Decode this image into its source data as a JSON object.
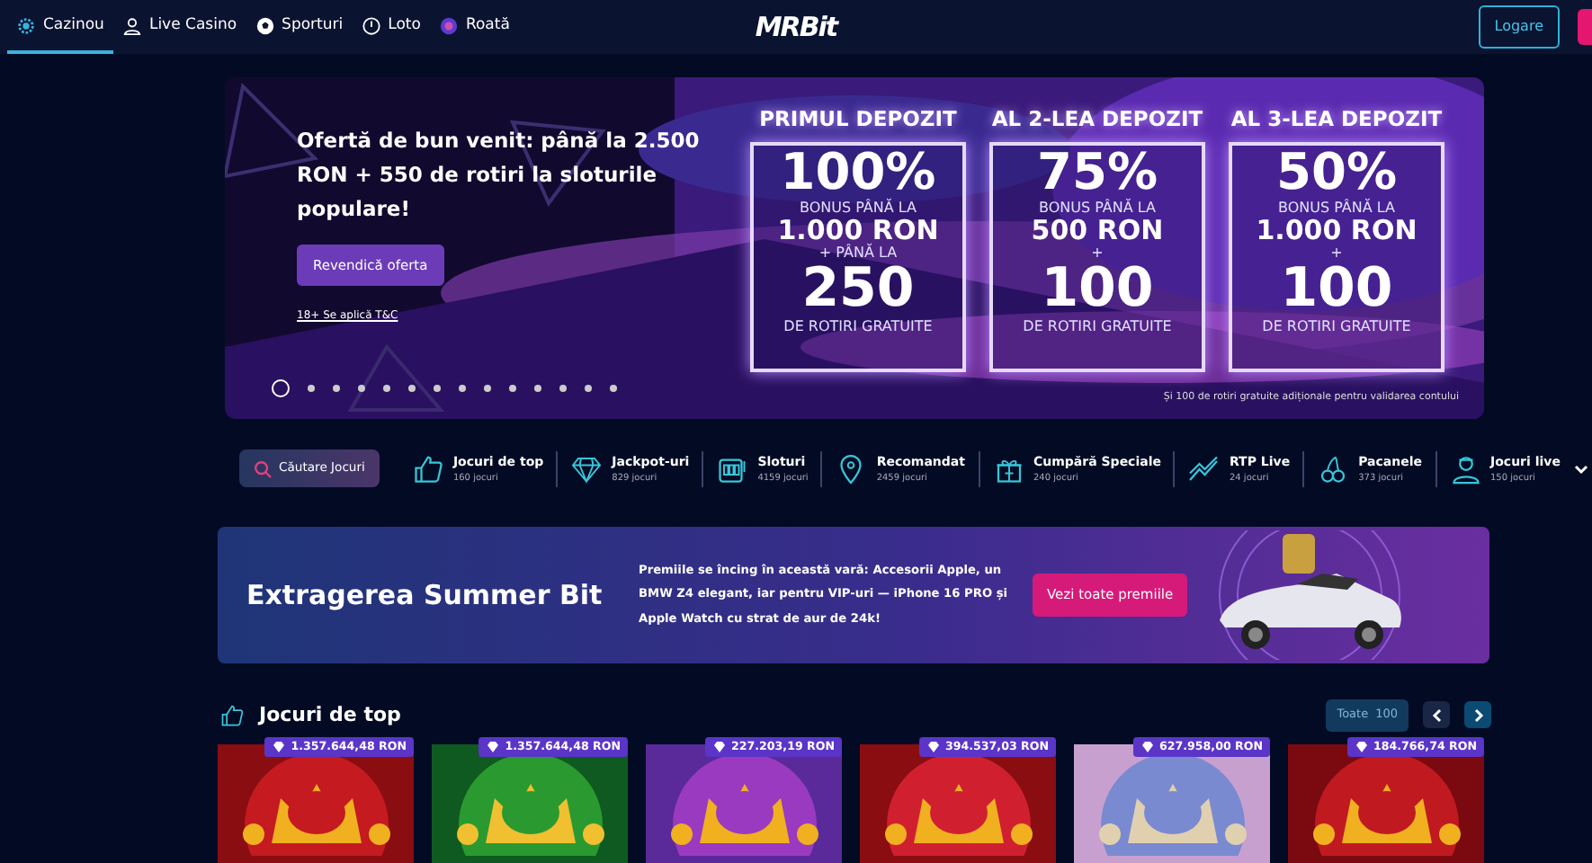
{
  "nav": {
    "items": [
      {
        "label": "Cazinou",
        "selected": true
      },
      {
        "label": "Live Casino",
        "selected": false
      },
      {
        "label": "Sporturi",
        "selected": false
      },
      {
        "label": "Loto",
        "selected": false
      },
      {
        "label": "Roată",
        "selected": false
      }
    ],
    "logo": "MRBit",
    "login": "Logare"
  },
  "hero": {
    "title": "Ofertă de bun venit: până la 2.500 RON + 550 de rotiri la sloturile populare!",
    "cta": "Revendică oferta",
    "terms": "18+ Se aplică T&C",
    "offers": [
      {
        "heading": "PRIMUL DEPOZIT",
        "percent": "100%",
        "lines": [
          "BONUS PÂNĂ LA",
          "1.000 RON",
          "+ PÂNĂ LA"
        ],
        "big": "250",
        "foot": "DE ROTIRI GRATUITE"
      },
      {
        "heading": "AL 2-LEA DEPOZIT",
        "percent": "75%",
        "lines": [
          "BONUS PÂNĂ LA",
          "500 RON",
          "+"
        ],
        "big": "100",
        "foot": "DE ROTIRI GRATUITE"
      },
      {
        "heading": "AL 3-LEA DEPOZIT",
        "percent": "50%",
        "lines": [
          "BONUS PÂNĂ LA",
          "1.000 RON",
          "+"
        ],
        "big": "100",
        "foot": "DE ROTIRI GRATUITE"
      }
    ],
    "note": "Și 100 de rotiri gratuite adiționale pentru validarea contului",
    "dots": [
      {
        "selected": true
      },
      {
        "selected": false
      },
      {
        "selected": false
      },
      {
        "selected": false
      },
      {
        "selected": false
      },
      {
        "selected": false
      },
      {
        "selected": false
      },
      {
        "selected": false
      },
      {
        "selected": false
      },
      {
        "selected": false
      },
      {
        "selected": false
      },
      {
        "selected": false
      },
      {
        "selected": false
      },
      {
        "selected": false
      }
    ]
  },
  "categories": {
    "search": "Căutare Jocuri",
    "items": [
      {
        "label": "Jocuri de top",
        "count": "160 jocuri"
      },
      {
        "label": "Jackpot-uri",
        "count": "829 jocuri"
      },
      {
        "label": "Sloturi",
        "count": "4159 jocuri"
      },
      {
        "label": "Recomandat",
        "count": "2459 jocuri"
      },
      {
        "label": "Cumpără Speciale",
        "count": "240 jocuri"
      },
      {
        "label": "RTP Live",
        "count": "24 jocuri"
      },
      {
        "label": "Pacanele",
        "count": "373 jocuri"
      },
      {
        "label": "Jocuri live",
        "count": "150 jocuri"
      }
    ]
  },
  "promo": {
    "title": "Extragerea Summer Bit",
    "text": "Premiile se încing în această vară: Accesorii Apple, un BMW Z4 elegant, iar pentru VIP-uri — iPhone 16 PRO și Apple Watch cu strat de aur de 24k!",
    "button": "Vezi toate premiile"
  },
  "top_games": {
    "title": "Jocuri de top",
    "all": "Toate",
    "count": "100",
    "games": [
      {
        "jackpot": "1.357.644,48 RON",
        "kind": "picture"
      },
      {
        "jackpot": "1.357.644,48 RON",
        "kind": "picture"
      },
      {
        "jackpot": "227.203,19 RON",
        "kind": "picture"
      },
      {
        "jackpot": "394.537,03 RON",
        "kind": "picture"
      },
      {
        "jackpot": "627.958,00 RON",
        "kind": "picture"
      },
      {
        "jackpot": "184.766,74 RON",
        "kind": "picture"
      }
    ]
  }
}
